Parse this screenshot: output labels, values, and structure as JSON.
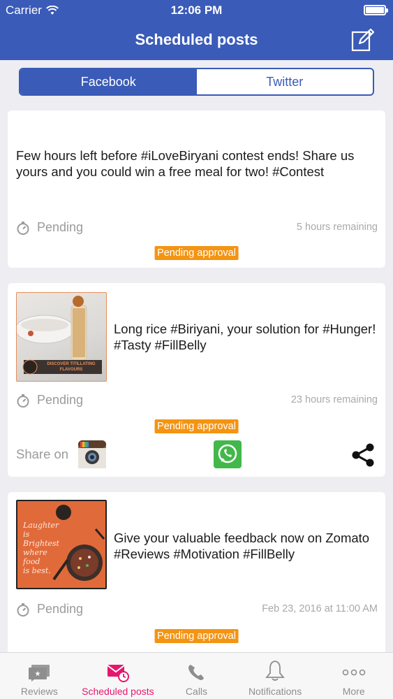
{
  "status_bar": {
    "carrier": "Carrier",
    "time": "12:06 PM"
  },
  "header": {
    "title": "Scheduled posts"
  },
  "segments": [
    {
      "label": "Facebook",
      "active": true
    },
    {
      "label": "Twitter",
      "active": false
    }
  ],
  "posts": [
    {
      "text": "Few hours left before #iLoveBiryani contest ends! Share us yours and you could win a free meal for two! #Contest",
      "status": "Pending",
      "time_info": "5 hours remaining",
      "badge": "Pending approval"
    },
    {
      "text": "Long rice #Biriyani, your solution for #Hunger! #Tasty #FillBelly",
      "status": "Pending",
      "time_info": "23 hours remaining",
      "badge": "Pending approval",
      "image_caption": "DISCOVER TITILLATING FLAVOURS",
      "share_label": "Share on"
    },
    {
      "text": "Give your valuable feedback now on Zomato #Reviews #Motivation #FillBelly",
      "status": "Pending",
      "time_info": "Feb 23, 2016 at 11:00 AM",
      "badge": "Pending approval",
      "image_lines": [
        "Laughter",
        "is",
        "Brightest",
        "where",
        "food",
        "is best."
      ]
    }
  ],
  "tabbar": [
    {
      "label": "Reviews",
      "icon": "reviews-icon",
      "active": false
    },
    {
      "label": "Scheduled posts",
      "icon": "scheduled-mail-icon",
      "active": true
    },
    {
      "label": "Calls",
      "icon": "phone-icon",
      "active": false
    },
    {
      "label": "Notifications",
      "icon": "bell-icon",
      "active": false
    },
    {
      "label": "More",
      "icon": "more-dots-icon",
      "active": false
    }
  ],
  "colors": {
    "brand": "#3a5bb7",
    "accent": "#e5176d",
    "badge": "#f39413"
  }
}
